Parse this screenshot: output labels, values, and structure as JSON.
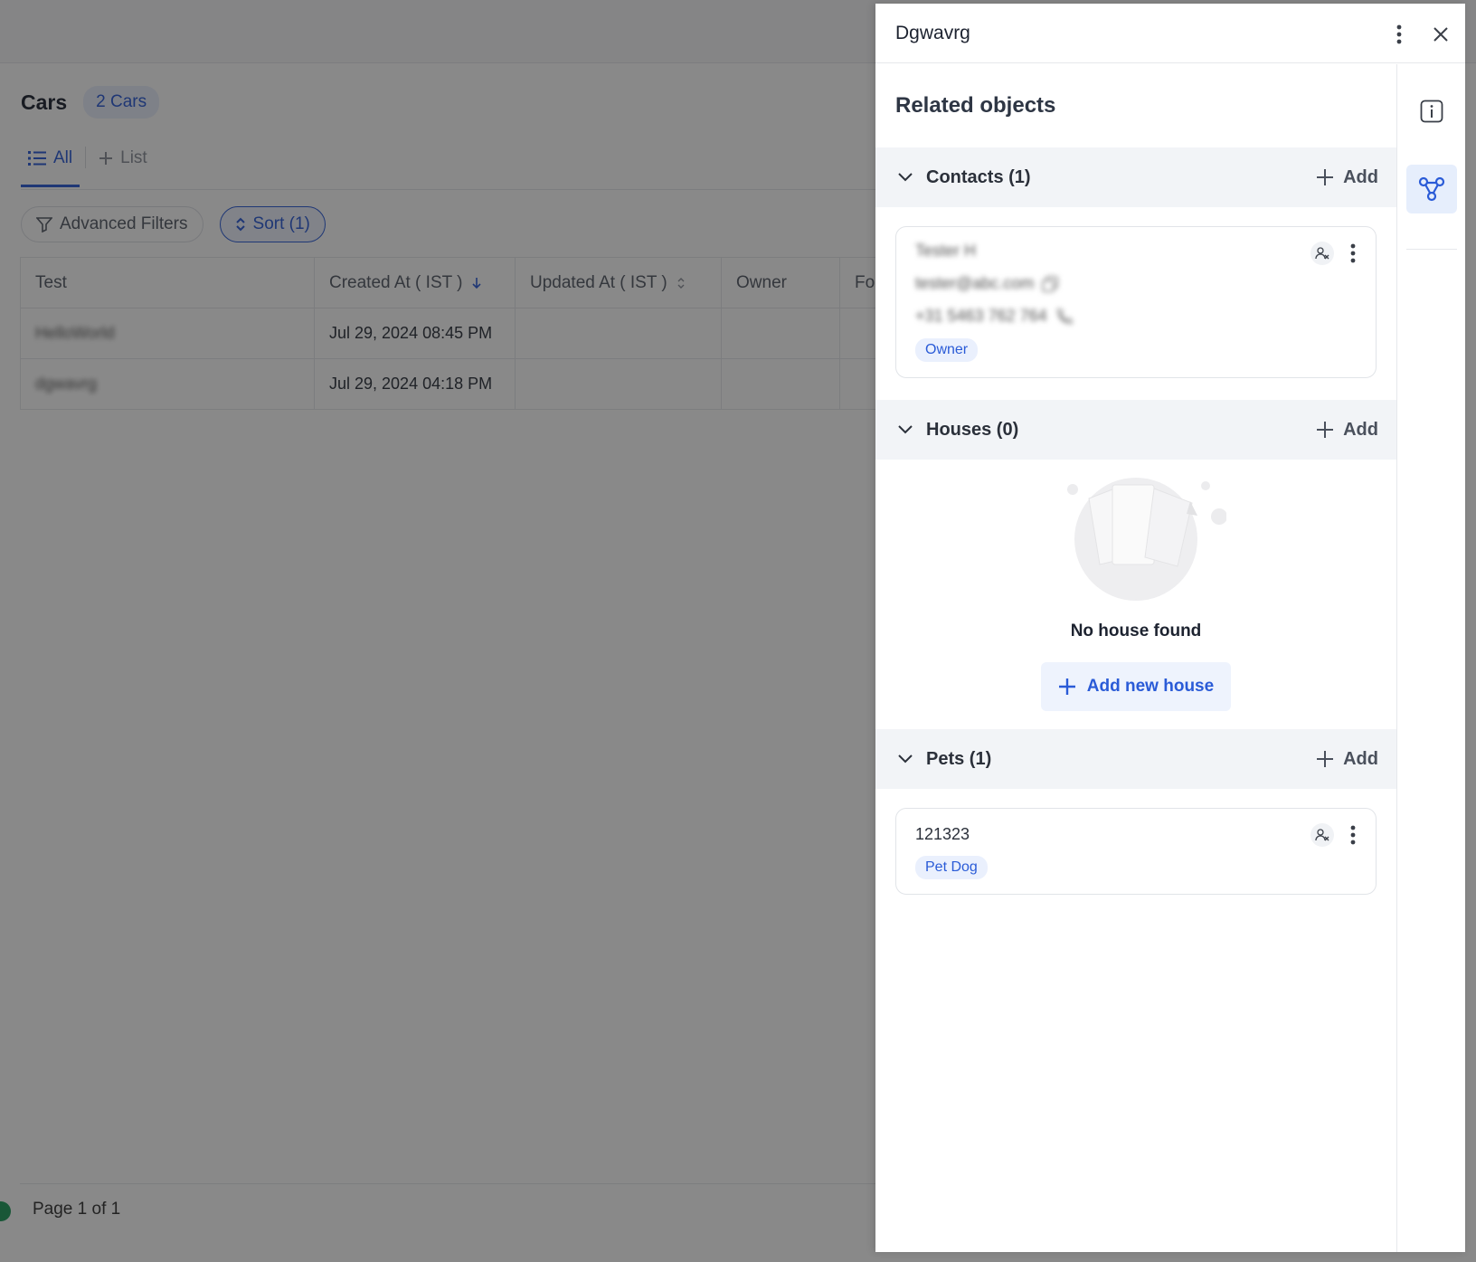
{
  "background": {
    "page_title": "Cars",
    "count_badge": "2 Cars",
    "tabs": [
      {
        "label": "All",
        "active": true
      },
      {
        "label": "List",
        "active": false
      }
    ],
    "filters": {
      "advanced_label": "Advanced Filters",
      "sort_label": "Sort (1)"
    },
    "table": {
      "columns": [
        "Test",
        "Created At ( IST )",
        "Updated At ( IST )",
        "Owner",
        "Fo"
      ],
      "rows": [
        {
          "test": "HelloWorld",
          "created": "Jul 29, 2024 08:45 PM",
          "updated": "",
          "owner": ""
        },
        {
          "test": "dgwavrg",
          "created": "Jul 29, 2024 04:18 PM",
          "updated": "",
          "owner": ""
        }
      ]
    },
    "footer": "Page 1 of 1"
  },
  "drawer": {
    "title": "Dgwavrg",
    "section_title": "Related objects",
    "contacts": {
      "header": "Contacts (1)",
      "add_label": "Add",
      "card": {
        "name": "Tester H",
        "email": "tester@abc.com",
        "phone": "+31 5463 762 764",
        "tag": "Owner"
      }
    },
    "houses": {
      "header": "Houses (0)",
      "add_label": "Add",
      "empty_text": "No house found",
      "add_new_label": "Add new house"
    },
    "pets": {
      "header": "Pets (1)",
      "add_label": "Add",
      "card": {
        "name": "121323",
        "tag": "Pet Dog"
      }
    }
  },
  "colors": {
    "accent": "#2a5bd7",
    "overlay": "#7f7f7f"
  }
}
